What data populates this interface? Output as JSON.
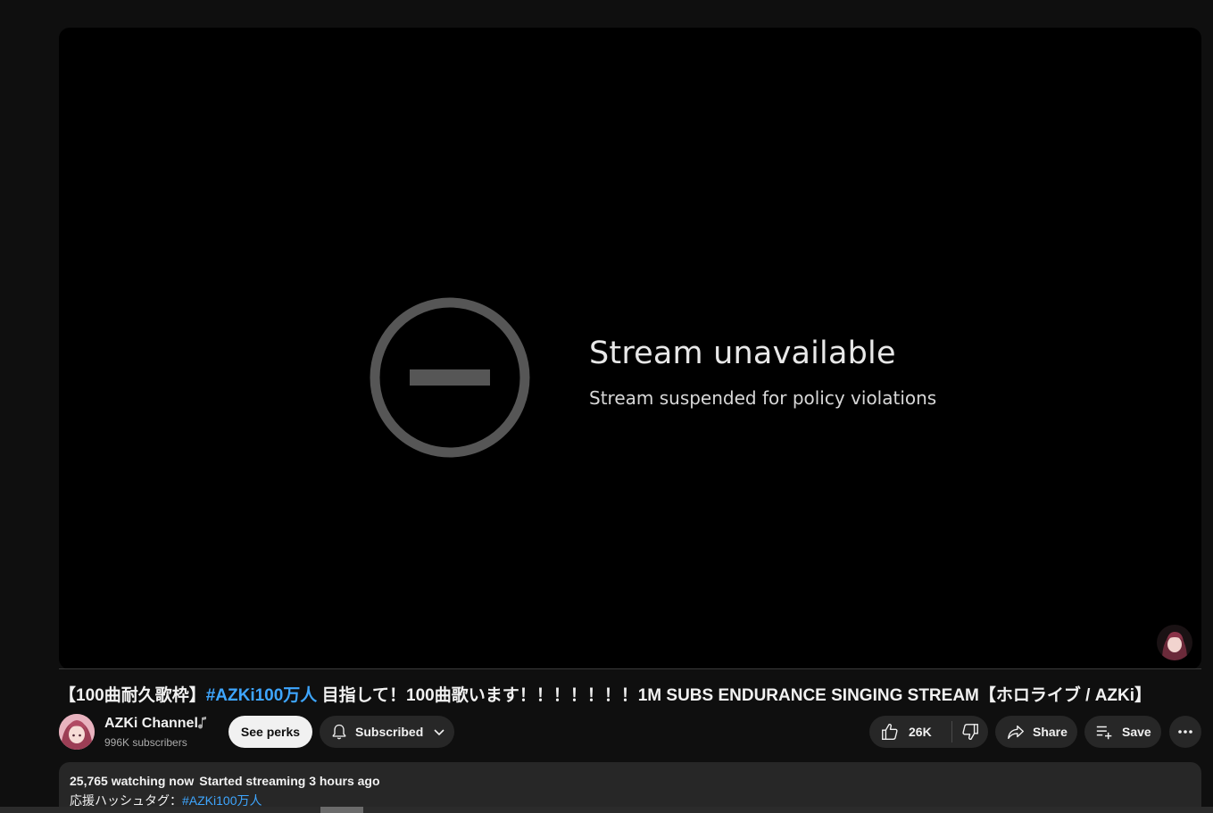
{
  "player": {
    "error_title": "Stream unavailable",
    "error_subtitle": "Stream suspended for policy violations"
  },
  "video": {
    "title_prefix": "【100曲耐久歌枠】",
    "title_hashtag": "#AZKi100万人",
    "title_rest": " 目指して！100曲歌います！！！！！！！1M SUBS ENDURANCE SINGING STREAM【ホロライブ / AZKi】"
  },
  "channel": {
    "name": "AZKi Channel",
    "subscribers": "996K subscribers"
  },
  "actions": {
    "perks_label": "See perks",
    "subscribed_label": "Subscribed",
    "like_count": "26K",
    "share_label": "Share",
    "save_label": "Save"
  },
  "description": {
    "watching": "25,765 watching now",
    "started": "Started streaming 3 hours ago",
    "line2_prefix": "応援ハッシュタグ：",
    "line2_hashtag": "#AZKi100万人"
  },
  "colors": {
    "background": "#0f0f0f",
    "button_bg": "#272727",
    "link": "#3ea6ff"
  }
}
